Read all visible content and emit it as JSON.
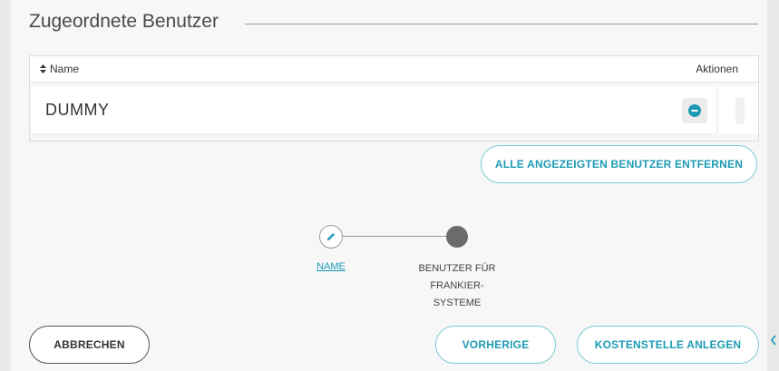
{
  "section": {
    "title": "Zugeordnete Benutzer"
  },
  "table": {
    "columns": {
      "name": "Name",
      "actions": "Aktionen"
    },
    "rows": [
      {
        "name": "DUMMY"
      }
    ]
  },
  "buttons": {
    "remove_all": "ALLE ANGEZEIGTEN BENUTZER ENTFERNEN",
    "cancel": "ABBRECHEN",
    "previous": "VORHERIGE",
    "create": "KOSTENSTELLE ANLEGEN"
  },
  "steps": [
    {
      "label": "NAME",
      "state": "completed",
      "icon": "pencil-icon"
    },
    {
      "label_lines": [
        "BENUTZER FÜR",
        "FRANKIER-",
        "SYSTEME"
      ],
      "state": "current"
    }
  ],
  "colors": {
    "accent": "#1d9bb4",
    "accent_border": "#7fc8d6",
    "step_current": "#6b6b6b"
  }
}
